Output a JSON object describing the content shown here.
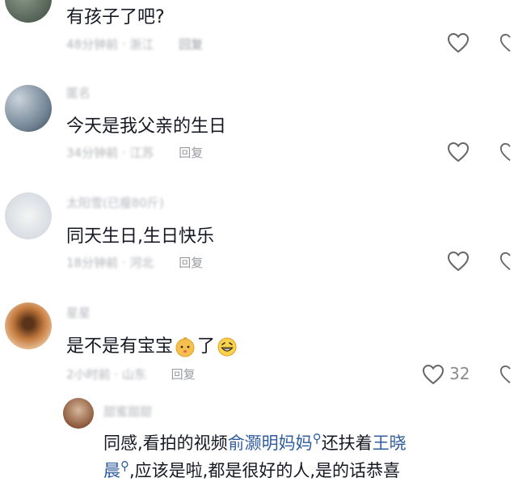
{
  "comments": [
    {
      "username": "hidden",
      "text": "有孩子了吧?",
      "time_location": "48分钟前 · 浙江",
      "reply_label": "回复",
      "likes": ""
    },
    {
      "username": "匿名",
      "text": "今天是我父亲的生日",
      "time_location": "34分钟前 · 江苏",
      "reply_label": "回复",
      "likes": ""
    },
    {
      "username": "太阳雪(已瘦80斤)",
      "text": "同天生日,生日快乐",
      "time_location": "18分钟前 · 河北",
      "reply_label": "回复",
      "likes": ""
    },
    {
      "username": "星星",
      "text_before": "是不是有宝宝",
      "text_after": "了",
      "time_location": "2小时前 · 山东",
      "reply_label": "回复",
      "likes": "32"
    }
  ],
  "reply": {
    "username": "甜蜜甜甜",
    "line1_prefix": "同感,看拍的视频",
    "link1": "俞灏明妈妈",
    "line1_middle": "还扶着",
    "link2_part1": "王晓",
    "link2_part2": "晨",
    "line2_suffix": ",应该是啦,都是很好的人,是的话恭喜"
  },
  "icons": {
    "like": "heart-outline-icon",
    "search": "search-icon"
  }
}
